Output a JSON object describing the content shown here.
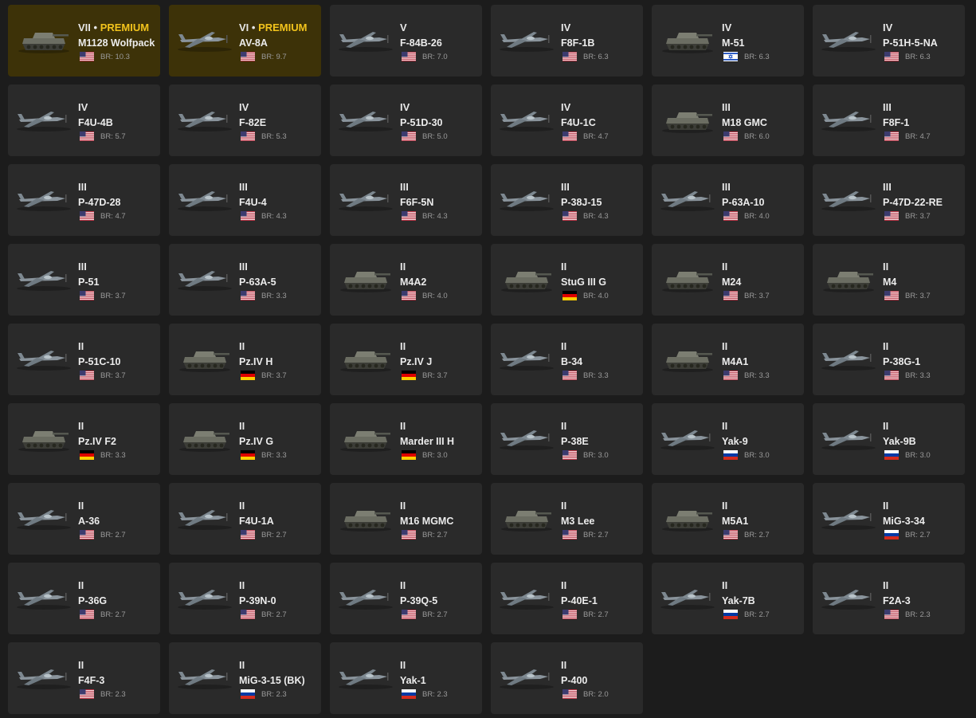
{
  "br_prefix": "BR:",
  "premium_label": "PREMIUM",
  "colors": {
    "background": "#1c1c1c",
    "card": "#2a2a2a",
    "premium_card": "#3d3208",
    "premium_text": "#f2c31c"
  },
  "vehicles": [
    {
      "tier": "VII",
      "premium": true,
      "name": "M1128 Wolfpack",
      "nation": "usa",
      "br": "10.3",
      "kind": "tank"
    },
    {
      "tier": "VI",
      "premium": true,
      "name": "AV-8A",
      "nation": "usa",
      "br": "9.7",
      "kind": "plane"
    },
    {
      "tier": "V",
      "premium": false,
      "name": "F-84B-26",
      "nation": "usa",
      "br": "7.0",
      "kind": "plane"
    },
    {
      "tier": "IV",
      "premium": false,
      "name": "F8F-1B",
      "nation": "usa",
      "br": "6.3",
      "kind": "plane"
    },
    {
      "tier": "IV",
      "premium": false,
      "name": "M-51",
      "nation": "israel",
      "br": "6.3",
      "kind": "tank"
    },
    {
      "tier": "IV",
      "premium": false,
      "name": "P-51H-5-NA",
      "nation": "usa",
      "br": "6.3",
      "kind": "plane"
    },
    {
      "tier": "IV",
      "premium": false,
      "name": "F4U-4B",
      "nation": "usa",
      "br": "5.7",
      "kind": "plane"
    },
    {
      "tier": "IV",
      "premium": false,
      "name": "F-82E",
      "nation": "usa",
      "br": "5.3",
      "kind": "plane"
    },
    {
      "tier": "IV",
      "premium": false,
      "name": "P-51D-30",
      "nation": "usa",
      "br": "5.0",
      "kind": "plane"
    },
    {
      "tier": "IV",
      "premium": false,
      "name": "F4U-1C",
      "nation": "usa",
      "br": "4.7",
      "kind": "plane"
    },
    {
      "tier": "III",
      "premium": false,
      "name": "M18 GMC",
      "nation": "usa",
      "br": "6.0",
      "kind": "tank"
    },
    {
      "tier": "III",
      "premium": false,
      "name": "F8F-1",
      "nation": "usa",
      "br": "4.7",
      "kind": "plane"
    },
    {
      "tier": "III",
      "premium": false,
      "name": "P-47D-28",
      "nation": "usa",
      "br": "4.7",
      "kind": "plane"
    },
    {
      "tier": "III",
      "premium": false,
      "name": "F4U-4",
      "nation": "usa",
      "br": "4.3",
      "kind": "plane"
    },
    {
      "tier": "III",
      "premium": false,
      "name": "F6F-5N",
      "nation": "usa",
      "br": "4.3",
      "kind": "plane"
    },
    {
      "tier": "III",
      "premium": false,
      "name": "P-38J-15",
      "nation": "usa",
      "br": "4.3",
      "kind": "plane"
    },
    {
      "tier": "III",
      "premium": false,
      "name": "P-63A-10",
      "nation": "usa",
      "br": "4.0",
      "kind": "plane"
    },
    {
      "tier": "III",
      "premium": false,
      "name": "P-47D-22-RE",
      "nation": "usa",
      "br": "3.7",
      "kind": "plane"
    },
    {
      "tier": "III",
      "premium": false,
      "name": "P-51",
      "nation": "usa",
      "br": "3.7",
      "kind": "plane"
    },
    {
      "tier": "III",
      "premium": false,
      "name": "P-63A-5",
      "nation": "usa",
      "br": "3.3",
      "kind": "plane"
    },
    {
      "tier": "II",
      "premium": false,
      "name": "M4A2",
      "nation": "usa",
      "br": "4.0",
      "kind": "tank"
    },
    {
      "tier": "II",
      "premium": false,
      "name": "StuG III G",
      "nation": "germany",
      "br": "4.0",
      "kind": "tank"
    },
    {
      "tier": "II",
      "premium": false,
      "name": "M24",
      "nation": "usa",
      "br": "3.7",
      "kind": "tank"
    },
    {
      "tier": "II",
      "premium": false,
      "name": "M4",
      "nation": "usa",
      "br": "3.7",
      "kind": "tank"
    },
    {
      "tier": "II",
      "premium": false,
      "name": "P-51C-10",
      "nation": "usa",
      "br": "3.7",
      "kind": "plane"
    },
    {
      "tier": "II",
      "premium": false,
      "name": "Pz.IV H",
      "nation": "germany",
      "br": "3.7",
      "kind": "tank"
    },
    {
      "tier": "II",
      "premium": false,
      "name": "Pz.IV J",
      "nation": "germany",
      "br": "3.7",
      "kind": "tank"
    },
    {
      "tier": "II",
      "premium": false,
      "name": "B-34",
      "nation": "usa",
      "br": "3.3",
      "kind": "plane"
    },
    {
      "tier": "II",
      "premium": false,
      "name": "M4A1",
      "nation": "usa",
      "br": "3.3",
      "kind": "tank"
    },
    {
      "tier": "II",
      "premium": false,
      "name": "P-38G-1",
      "nation": "usa",
      "br": "3.3",
      "kind": "plane"
    },
    {
      "tier": "II",
      "premium": false,
      "name": "Pz.IV F2",
      "nation": "germany",
      "br": "3.3",
      "kind": "tank"
    },
    {
      "tier": "II",
      "premium": false,
      "name": "Pz.IV G",
      "nation": "germany",
      "br": "3.3",
      "kind": "tank"
    },
    {
      "tier": "II",
      "premium": false,
      "name": "Marder III H",
      "nation": "germany",
      "br": "3.0",
      "kind": "tank"
    },
    {
      "tier": "II",
      "premium": false,
      "name": "P-38E",
      "nation": "usa",
      "br": "3.0",
      "kind": "plane"
    },
    {
      "tier": "II",
      "premium": false,
      "name": "Yak-9",
      "nation": "russia",
      "br": "3.0",
      "kind": "plane"
    },
    {
      "tier": "II",
      "premium": false,
      "name": "Yak-9B",
      "nation": "russia",
      "br": "3.0",
      "kind": "plane"
    },
    {
      "tier": "II",
      "premium": false,
      "name": "A-36",
      "nation": "usa",
      "br": "2.7",
      "kind": "plane"
    },
    {
      "tier": "II",
      "premium": false,
      "name": "F4U-1A",
      "nation": "usa",
      "br": "2.7",
      "kind": "plane"
    },
    {
      "tier": "II",
      "premium": false,
      "name": "M16 MGMC",
      "nation": "usa",
      "br": "2.7",
      "kind": "tank"
    },
    {
      "tier": "II",
      "premium": false,
      "name": "M3 Lee",
      "nation": "usa",
      "br": "2.7",
      "kind": "tank"
    },
    {
      "tier": "II",
      "premium": false,
      "name": "M5A1",
      "nation": "usa",
      "br": "2.7",
      "kind": "tank"
    },
    {
      "tier": "II",
      "premium": false,
      "name": "MiG-3-34",
      "nation": "russia",
      "br": "2.7",
      "kind": "plane"
    },
    {
      "tier": "II",
      "premium": false,
      "name": "P-36G",
      "nation": "usa",
      "br": "2.7",
      "kind": "plane"
    },
    {
      "tier": "II",
      "premium": false,
      "name": "P-39N-0",
      "nation": "usa",
      "br": "2.7",
      "kind": "plane"
    },
    {
      "tier": "II",
      "premium": false,
      "name": "P-39Q-5",
      "nation": "usa",
      "br": "2.7",
      "kind": "plane"
    },
    {
      "tier": "II",
      "premium": false,
      "name": "P-40E-1",
      "nation": "usa",
      "br": "2.7",
      "kind": "plane"
    },
    {
      "tier": "II",
      "premium": false,
      "name": "Yak-7B",
      "nation": "russia",
      "br": "2.7",
      "kind": "plane"
    },
    {
      "tier": "II",
      "premium": false,
      "name": "F2A-3",
      "nation": "usa",
      "br": "2.3",
      "kind": "plane"
    },
    {
      "tier": "II",
      "premium": false,
      "name": "F4F-3",
      "nation": "usa",
      "br": "2.3",
      "kind": "plane"
    },
    {
      "tier": "II",
      "premium": false,
      "name": "MiG-3-15 (BK)",
      "nation": "russia",
      "br": "2.3",
      "kind": "plane"
    },
    {
      "tier": "II",
      "premium": false,
      "name": "Yak-1",
      "nation": "russia",
      "br": "2.3",
      "kind": "plane"
    },
    {
      "tier": "II",
      "premium": false,
      "name": "P-400",
      "nation": "usa",
      "br": "2.0",
      "kind": "plane"
    }
  ]
}
